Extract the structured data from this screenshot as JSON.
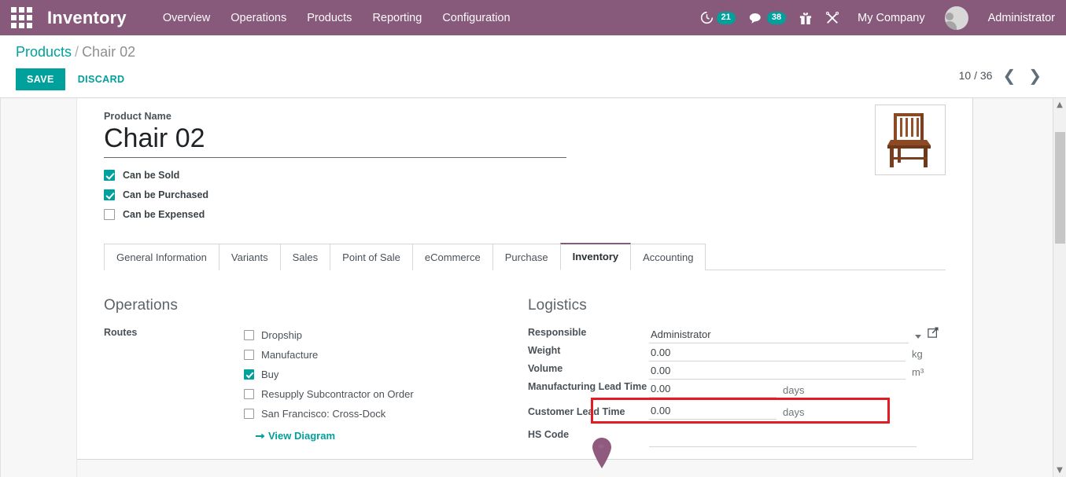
{
  "navbar": {
    "apps_icon": "apps-grid-icon",
    "brand": "Inventory",
    "menu": [
      {
        "label": "Overview"
      },
      {
        "label": "Operations"
      },
      {
        "label": "Products"
      },
      {
        "label": "Reporting"
      },
      {
        "label": "Configuration"
      }
    ],
    "activity": {
      "icon": "clock-activity-icon",
      "count": "21"
    },
    "messaging": {
      "icon": "chat-bubble-icon",
      "count": "38"
    },
    "gift": {
      "icon": "gift-icon"
    },
    "tools": {
      "icon": "tools-icon"
    },
    "company": "My Company",
    "user": "Administrator",
    "avatar_icon": "user-avatar-icon",
    "accent_purple": "#875A7B",
    "accent_teal": "#00A09D"
  },
  "control_panel": {
    "breadcrumb_root": "Products",
    "breadcrumb_separator": "/",
    "breadcrumb_current": "Chair 02",
    "save_label": "SAVE",
    "discard_label": "DISCARD",
    "pager_value": "10 / 36",
    "pager_prev_icon": "chevron-left-icon",
    "pager_next_icon": "chevron-right-icon"
  },
  "form": {
    "product_name_caption": "Product Name",
    "product_name_value": "Chair 02",
    "product_image_icon": "chair-product-image",
    "flags": [
      {
        "label": "Can be Sold",
        "checked": true
      },
      {
        "label": "Can be Purchased",
        "checked": true
      },
      {
        "label": "Can be Expensed",
        "checked": false
      }
    ],
    "tabs": [
      {
        "label": "General Information",
        "active": false
      },
      {
        "label": "Variants",
        "active": false
      },
      {
        "label": "Sales",
        "active": false
      },
      {
        "label": "Point of Sale",
        "active": false
      },
      {
        "label": "eCommerce",
        "active": false
      },
      {
        "label": "Purchase",
        "active": false
      },
      {
        "label": "Inventory",
        "active": true
      },
      {
        "label": "Accounting",
        "active": false
      }
    ],
    "operations": {
      "title": "Operations",
      "routes_label": "Routes",
      "routes": [
        {
          "label": "Dropship",
          "checked": false
        },
        {
          "label": "Manufacture",
          "checked": false
        },
        {
          "label": "Buy",
          "checked": true
        },
        {
          "label": "Resupply Subcontractor on Order",
          "checked": false
        },
        {
          "label": "San Francisco: Cross-Dock",
          "checked": false
        }
      ],
      "view_diagram_label": "View Diagram",
      "view_diagram_icon": "arrow-right-icon"
    },
    "logistics": {
      "title": "Logistics",
      "responsible_label": "Responsible",
      "responsible_value": "Administrator",
      "responsible_caret_icon": "chevron-down-icon",
      "responsible_open_icon": "external-link-icon",
      "weight_label": "Weight",
      "weight_value": "0.00",
      "weight_unit": "kg",
      "volume_label": "Volume",
      "volume_value": "0.00",
      "volume_unit": "m³",
      "manufacturing_lead_time_label": "Manufacturing Lead Time",
      "manufacturing_lead_time_value": "0.00",
      "manufacturing_lead_time_unit": "days",
      "customer_lead_time_label": "Customer Lead Time",
      "customer_lead_time_value": "0.00",
      "customer_lead_time_unit": "days",
      "hs_code_label": "HS Code",
      "hs_code_value": ""
    },
    "highlight_color": "#E31B23",
    "pin_marker_icon": "map-pin-cursor-marker"
  },
  "scrollbar": {
    "up_icon": "chevron-up-icon",
    "down_icon": "chevron-down-icon"
  }
}
